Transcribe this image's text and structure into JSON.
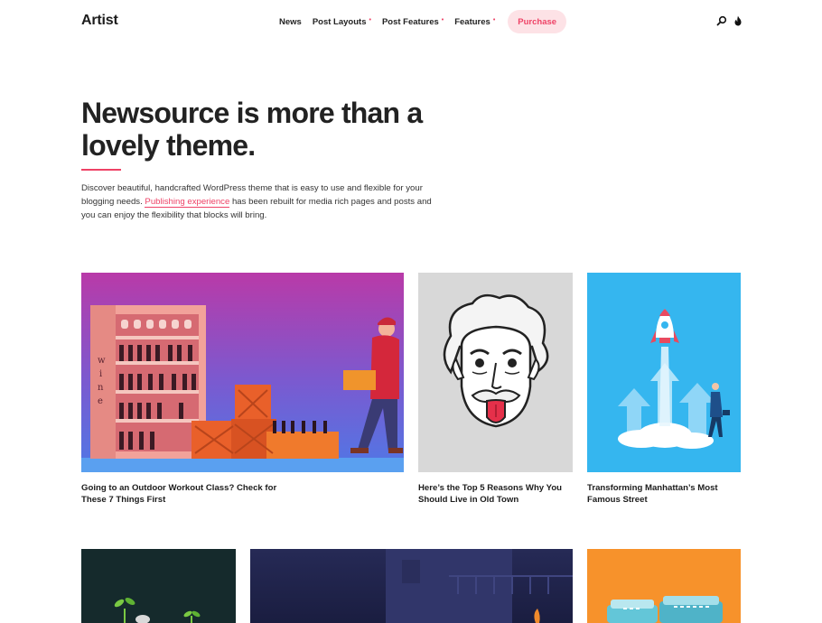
{
  "header": {
    "logo": "Artist",
    "nav": [
      {
        "label": "News",
        "has_dropdown": false
      },
      {
        "label": "Post Layouts",
        "has_dropdown": true
      },
      {
        "label": "Post Features",
        "has_dropdown": true
      },
      {
        "label": "Features",
        "has_dropdown": true
      }
    ],
    "dropdown_marker": "•",
    "purchase_label": "Purchase",
    "icons": [
      "search-icon",
      "flame-icon"
    ]
  },
  "hero": {
    "title": "Newsource is more than a lovely theme.",
    "desc_before": "Discover beautiful, handcrafted WordPress theme that is easy to use and flexible for your blogging needs.",
    "desc_link": "Publishing experience",
    "desc_after": "has been rebuilt for media rich pages and posts and you can enjoy the flexibility that blocks will bring."
  },
  "posts": [
    {
      "title": "Going to an Outdoor Workout Class? Check for These 7 Things First",
      "image": "wine-store-delivery-illustration"
    },
    {
      "title": "Here’s the Top 5 Reasons Why You Should Live in Old Town",
      "image": "einstein-tongue-illustration"
    },
    {
      "title": "Transforming Manhattan’s Most Famous Street",
      "image": "rocket-launch-illustration"
    },
    {
      "title": "",
      "image": "plant-sprouts-dark-illustration"
    },
    {
      "title": "",
      "image": "night-city-illustration"
    },
    {
      "title": "",
      "image": "orange-packages-illustration"
    }
  ],
  "colors": {
    "accent": "#ee4266",
    "accent_soft": "#fde2e6",
    "text": "#1c1c1c"
  }
}
